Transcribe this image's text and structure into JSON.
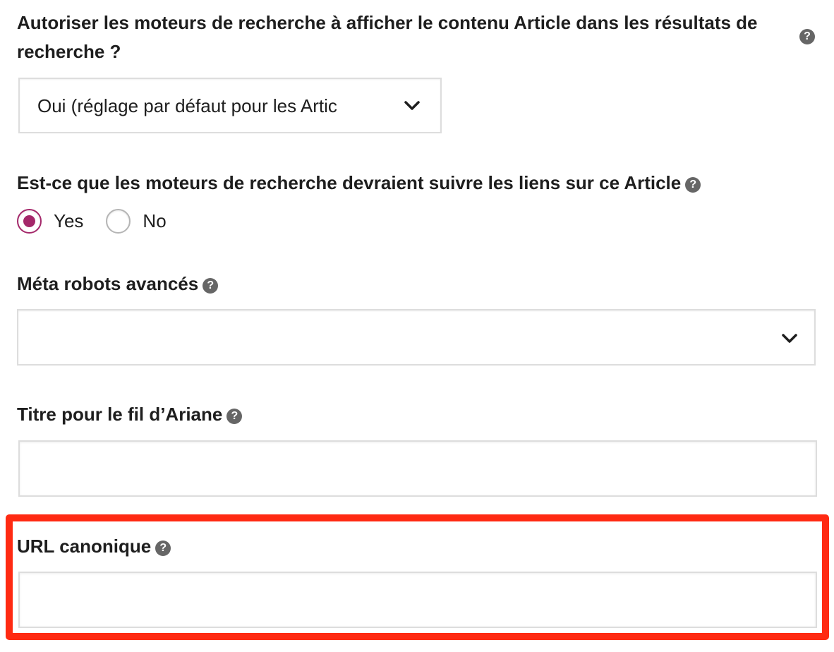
{
  "colors": {
    "accent": "#a4286a",
    "highlight": "#ff2a12",
    "help_icon": "#666666",
    "border": "#dddddd"
  },
  "fields": {
    "index_label": "Autoriser les moteurs de recherche à afficher le contenu Article dans les résultats de recherche ?",
    "index_select_value": "Oui (réglage par défaut pour les Artic",
    "follow_label": "Est-ce que les moteurs de recherche devraient suivre les liens sur ce Article",
    "follow_yes": "Yes",
    "follow_no": "No",
    "follow_selected": "Yes",
    "meta_robots_label": "Méta robots avancés",
    "meta_robots_value": "",
    "breadcrumb_label": "Titre pour le fil d’Ariane",
    "breadcrumb_value": "",
    "canonical_label": "URL canonique",
    "canonical_value": ""
  },
  "icons": {
    "help": "question-circle-icon",
    "dropdown": "chevron-down-icon",
    "help_glyph": "?"
  }
}
